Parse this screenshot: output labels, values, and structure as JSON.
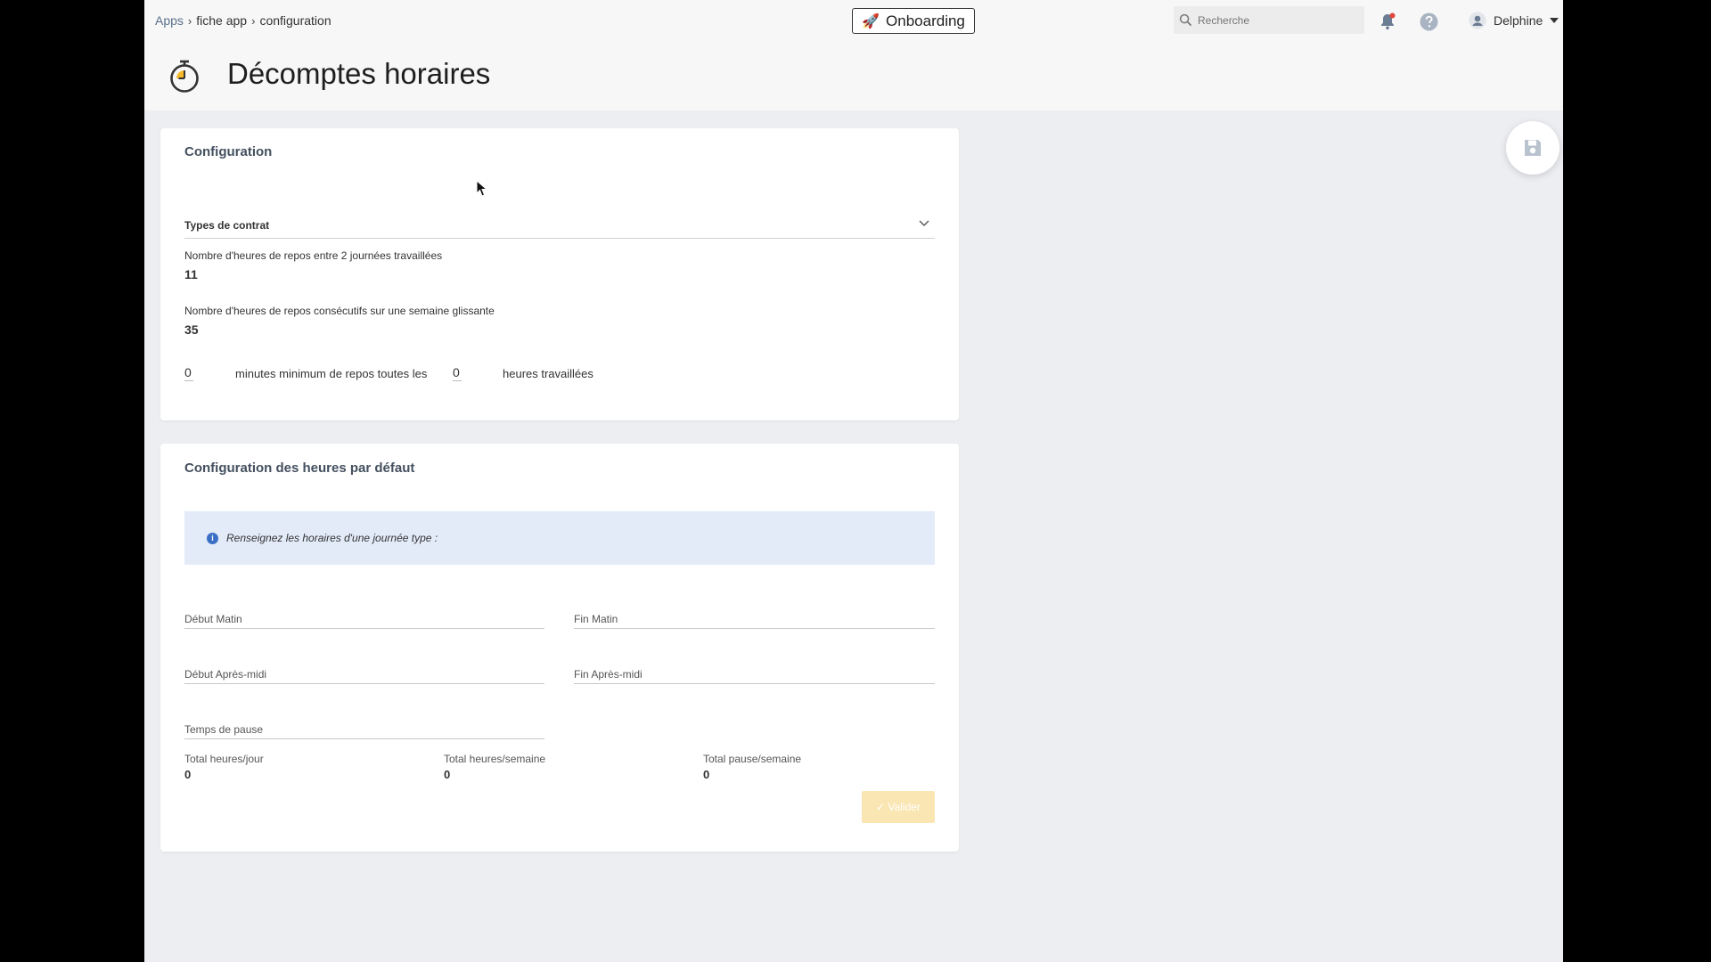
{
  "breadcrumb": {
    "items": [
      "Apps",
      "fiche app",
      "configuration"
    ]
  },
  "onboarding": {
    "label": "Onboarding"
  },
  "search": {
    "placeholder": "Recherche"
  },
  "user": {
    "name": "Delphine"
  },
  "page": {
    "title": "Décomptes horaires"
  },
  "config": {
    "title": "Configuration",
    "contract_select": "Types de contrat",
    "rest_between_days_label": "Nombre d'heures de repos entre 2 journées travaillées",
    "rest_between_days_value": "11",
    "rest_weekly_label": "Nombre d'heures de repos consécutifs sur une semaine glissante",
    "rest_weekly_value": "35",
    "min_rest_minutes": "0",
    "min_rest_text": "minutes minimum de repos toutes les",
    "worked_hours_value": "0",
    "worked_hours_text": "heures travaillées"
  },
  "default_hours": {
    "title": "Configuration des heures par défaut",
    "info": "Renseignez les horaires d'une journée type :",
    "morning_start": "Début Matin",
    "morning_end": "Fin Matin",
    "afternoon_start": "Début Après-midi",
    "afternoon_end": "Fin Après-midi",
    "break_time": "Temps de pause",
    "total_day_label": "Total heures/jour",
    "total_day_value": "0",
    "total_week_label": "Total heures/semaine",
    "total_week_value": "0",
    "total_break_label": "Total pause/semaine",
    "total_break_value": "0",
    "validate_label": "✓ Valider"
  },
  "colors": {
    "accent": "#3a6fc4",
    "info_bg": "#e3ebf9",
    "validate_bg": "#fae6b2"
  }
}
